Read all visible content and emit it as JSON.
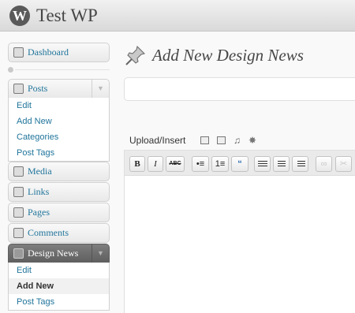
{
  "header": {
    "site_title": "Test WP",
    "logo_icon": "wordpress-logo-icon",
    "logo_glyph": "W"
  },
  "sidebar": {
    "dashboard": {
      "label": "Dashboard",
      "icon": "home-icon"
    },
    "posts": {
      "label": "Posts",
      "icon": "pushpin-icon",
      "arrow": "▼",
      "submenu": [
        "Edit",
        "Add New",
        "Categories",
        "Post Tags"
      ]
    },
    "media": {
      "label": "Media",
      "icon": "media-icon"
    },
    "links": {
      "label": "Links",
      "icon": "link-icon"
    },
    "pages": {
      "label": "Pages",
      "icon": "pages-icon"
    },
    "comments": {
      "label": "Comments",
      "icon": "comment-bubble-icon"
    },
    "design_news": {
      "label": "Design News",
      "icon": "pushpin-icon",
      "arrow": "▼",
      "submenu": [
        "Edit",
        "Add New",
        "Post Tags"
      ],
      "current_index": 1
    }
  },
  "main": {
    "page_title": "Add New Design News",
    "title_value": "",
    "upload_insert": "Upload/Insert",
    "media_icons": [
      "add-image-icon",
      "add-video-icon",
      "add-audio-icon",
      "add-media-icon"
    ],
    "toolbar": {
      "bold": "B",
      "italic": "I",
      "strikethrough": "ABC",
      "unordered_list": "•≡",
      "ordered_list": "1≡",
      "blockquote": "“",
      "link_icon": "link-icon",
      "unlink_icon": "unlink-icon"
    }
  },
  "colors": {
    "link": "#21759b",
    "active_menu": "#6d6d6d",
    "header_bg": "#e4e4e4"
  }
}
